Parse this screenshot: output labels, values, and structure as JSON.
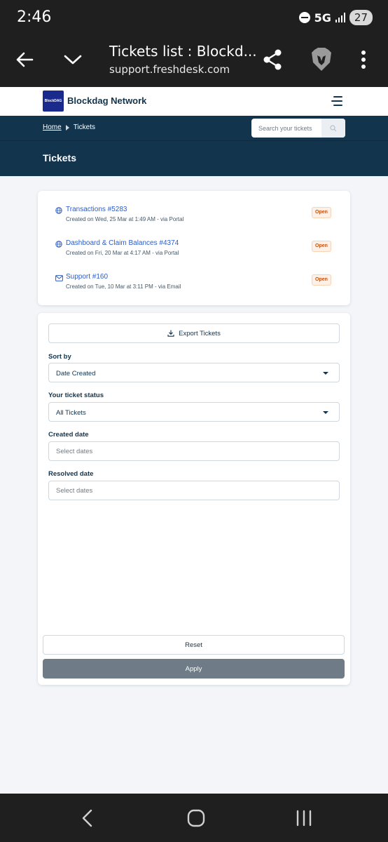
{
  "status_bar": {
    "time": "2:46",
    "network": "5G",
    "battery": "27"
  },
  "browser": {
    "tab_title": "Tickets list : Blockd...",
    "url": "support.freshdesk.com"
  },
  "site": {
    "name": "Blockdag Network",
    "logo_text": "BlockDAG"
  },
  "breadcrumb": {
    "home": "Home",
    "current": "Tickets"
  },
  "search": {
    "placeholder": "Search your tickets"
  },
  "page": {
    "title": "Tickets"
  },
  "tickets": [
    {
      "title": "Transactions #5283",
      "meta": "Created on Wed, 25 Mar at 1:49 AM - via Portal",
      "status": "Open",
      "source_icon": "globe-icon"
    },
    {
      "title": "Dashboard & Claim Balances #4374",
      "meta": "Created on Fri, 20 Mar at 4:17 AM - via Portal",
      "status": "Open",
      "source_icon": "globe-icon"
    },
    {
      "title": "Support #160",
      "meta": "Created on Tue, 10 Mar at 3:11 PM - via Email",
      "status": "Open",
      "source_icon": "email-icon"
    }
  ],
  "filters": {
    "export_label": "Export Tickets",
    "sort_by": {
      "label": "Sort by",
      "value": "Date Created"
    },
    "status": {
      "label": "Your ticket status",
      "value": "All Tickets"
    },
    "created": {
      "label": "Created date",
      "placeholder": "Select dates"
    },
    "resolved": {
      "label": "Resolved date",
      "placeholder": "Select dates"
    },
    "reset_label": "Reset",
    "apply_label": "Apply"
  },
  "colors": {
    "header_navy": "#12344d",
    "link_blue": "#2c5cc5",
    "open_badge": "#c4510f",
    "apply_gray": "#6f7c87"
  }
}
